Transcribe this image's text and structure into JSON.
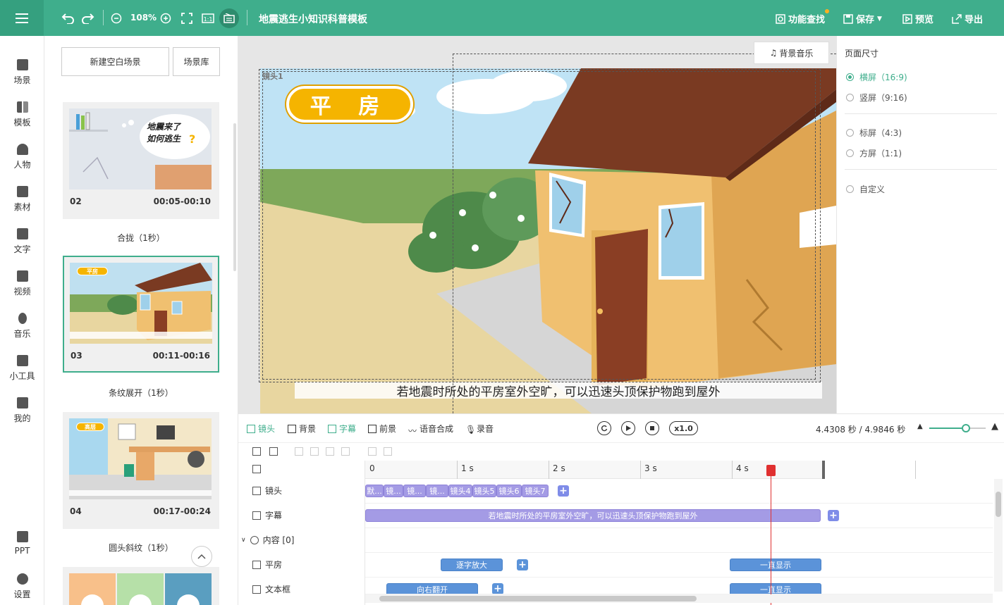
{
  "topbar": {
    "zoom": "108%",
    "title": "地震逃生小知识科普模板",
    "feature_search": "功能查找",
    "save": "保存",
    "preview": "预览",
    "export": "导出"
  },
  "nav": {
    "items": [
      {
        "label": "场景",
        "icon": "scene-icon"
      },
      {
        "label": "模板",
        "icon": "template-icon"
      },
      {
        "label": "人物",
        "icon": "person-icon"
      },
      {
        "label": "素材",
        "icon": "material-icon"
      },
      {
        "label": "文字",
        "icon": "text-icon"
      },
      {
        "label": "视频",
        "icon": "video-icon"
      },
      {
        "label": "音乐",
        "icon": "music-icon"
      },
      {
        "label": "小工具",
        "icon": "toolbox-icon"
      },
      {
        "label": "我的",
        "icon": "upload-icon"
      }
    ],
    "bottom": [
      {
        "label": "PPT",
        "icon": "ppt-icon"
      },
      {
        "label": "设置",
        "icon": "gear-icon"
      }
    ]
  },
  "scenes": {
    "new_blank": "新建空白场景",
    "library": "场景库",
    "cards": [
      {
        "num": "02",
        "time": "00:05-00:10",
        "transition": "合拢（1秒）",
        "bubble_line1": "地震来了",
        "bubble_line2": "如何逃生"
      },
      {
        "num": "03",
        "time": "00:11-00:16",
        "transition": "条纹展开（1秒）",
        "badge": "平房"
      },
      {
        "num": "04",
        "time": "00:17-00:24",
        "transition": "圆头斜纹（1秒）",
        "badge": "高层"
      }
    ]
  },
  "canvas": {
    "bgm": "背景音乐",
    "title_badge": "平  房",
    "subtitle": "若地震时所处的平房室外空旷，可以迅速头顶保护物跑到屋外",
    "corner_label": "镜头1"
  },
  "right_panel": {
    "title": "页面尺寸",
    "options": [
      {
        "label": "横屏（16:9)",
        "selected": true
      },
      {
        "label": "竖屏（9:16)",
        "selected": false
      },
      {
        "label": "标屏（4:3)",
        "selected": false
      },
      {
        "label": "方屏（1:1)",
        "selected": false
      },
      {
        "label": "自定义",
        "selected": false
      }
    ]
  },
  "timeline": {
    "tabs": [
      "镜头",
      "背景",
      "字幕",
      "前景",
      "语音合成",
      "录音"
    ],
    "active_tab": "字幕",
    "speed": "x1.0",
    "time_readout": "4.4308 秒 / 4.9846 秒",
    "zoom_level": 0.65,
    "ruler": [
      "0",
      "1 s",
      "2 s",
      "3 s",
      "4 s"
    ],
    "tracks": {
      "camera": "镜头",
      "subtitle": "字幕",
      "content": "内容 [0]",
      "pingfang": "平房",
      "textbox": "文本框"
    },
    "camera_clips": [
      "默...",
      "镜...",
      "镜...",
      "镜...",
      "镜头4",
      "镜头5",
      "镜头6",
      "镜头7"
    ],
    "subtitle_clip": "若地震时所处的平房室外空旷，可以迅速头顶保护物跑到屋外",
    "pingfang_clips": [
      "逐字放大",
      "一直显示"
    ],
    "textbox_clips": [
      "向右翻开",
      "一直显示"
    ]
  },
  "colors": {
    "accent": "#3fae8c",
    "clip_purple": "#a49be5",
    "clip_blue": "#5b93d9",
    "playhead": "#e03030"
  }
}
